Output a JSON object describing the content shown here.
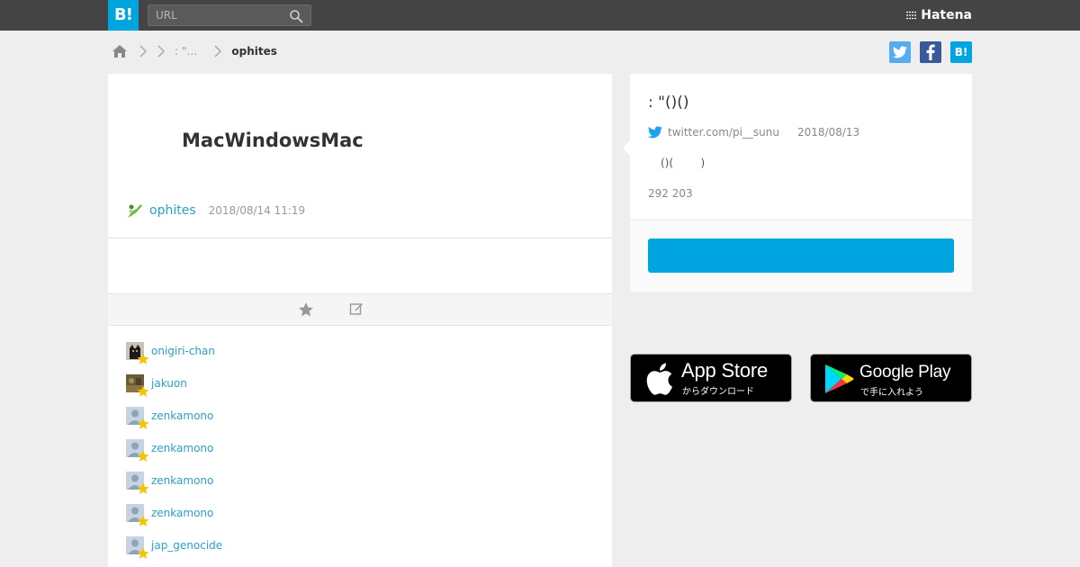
{
  "header": {
    "logo_text": "B!",
    "search_placeholder": "URL",
    "brand": "Hatena"
  },
  "breadcrumb": {
    "middle": ": \"…",
    "current": "ophites"
  },
  "share": {
    "hatena_label": "B!"
  },
  "entry": {
    "title": "MacWindowsMac",
    "user": "ophites",
    "timestamp": "2018/08/14 11:19"
  },
  "stars": [
    {
      "name": "onigiri-chan",
      "avatar": "cat"
    },
    {
      "name": "jakuon",
      "avatar": "photo"
    },
    {
      "name": "zenkamono",
      "avatar": "default"
    },
    {
      "name": "zenkamono",
      "avatar": "default"
    },
    {
      "name": "zenkamono",
      "avatar": "default"
    },
    {
      "name": "zenkamono",
      "avatar": "default"
    },
    {
      "name": "jap_genocide",
      "avatar": "default"
    }
  ],
  "side": {
    "title": ": \"()()",
    "source": "twitter.com/pi__sunu",
    "date": "2018/08/13",
    "quote": "()(        )",
    "counts": "292 203",
    "button_label": ""
  },
  "stores": {
    "apple_big": "App Store",
    "apple_small": "からダウンロード",
    "google_big": "Google Play",
    "google_small": "で手に入れよう"
  },
  "colors": {
    "accent": "#00a4de",
    "topbar": "#444444",
    "link": "#2b9fc7",
    "star": "#f5c400"
  }
}
